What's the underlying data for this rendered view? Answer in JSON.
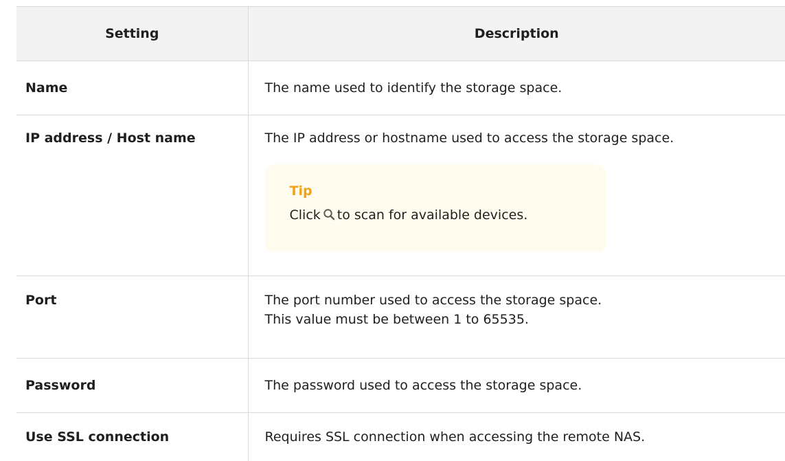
{
  "table": {
    "headers": {
      "setting": "Setting",
      "description": "Description"
    },
    "rows": [
      {
        "setting": "Name",
        "description": "The name used to identify the storage space."
      },
      {
        "setting": "IP address / Host name",
        "description": "The IP address or hostname used to access the storage space.",
        "tip": {
          "title": "Tip",
          "text_before": "Click",
          "icon": "search-icon",
          "text_after": "to scan for available devices."
        }
      },
      {
        "setting": "Port",
        "description_line1": "The port number used to access the storage space.",
        "description_line2": "This value must be between 1 to 65535."
      },
      {
        "setting": "Password",
        "description": "The password used to access the storage space."
      },
      {
        "setting": "Use SSL connection",
        "description": "Requires SSL connection when accessing the remote NAS."
      }
    ]
  },
  "colors": {
    "header_bg": "#f3f3f3",
    "border": "#d9d9d9",
    "tip_bg": "#fffcef",
    "tip_title": "#f0a21a",
    "icon": "#5b5b5b"
  }
}
